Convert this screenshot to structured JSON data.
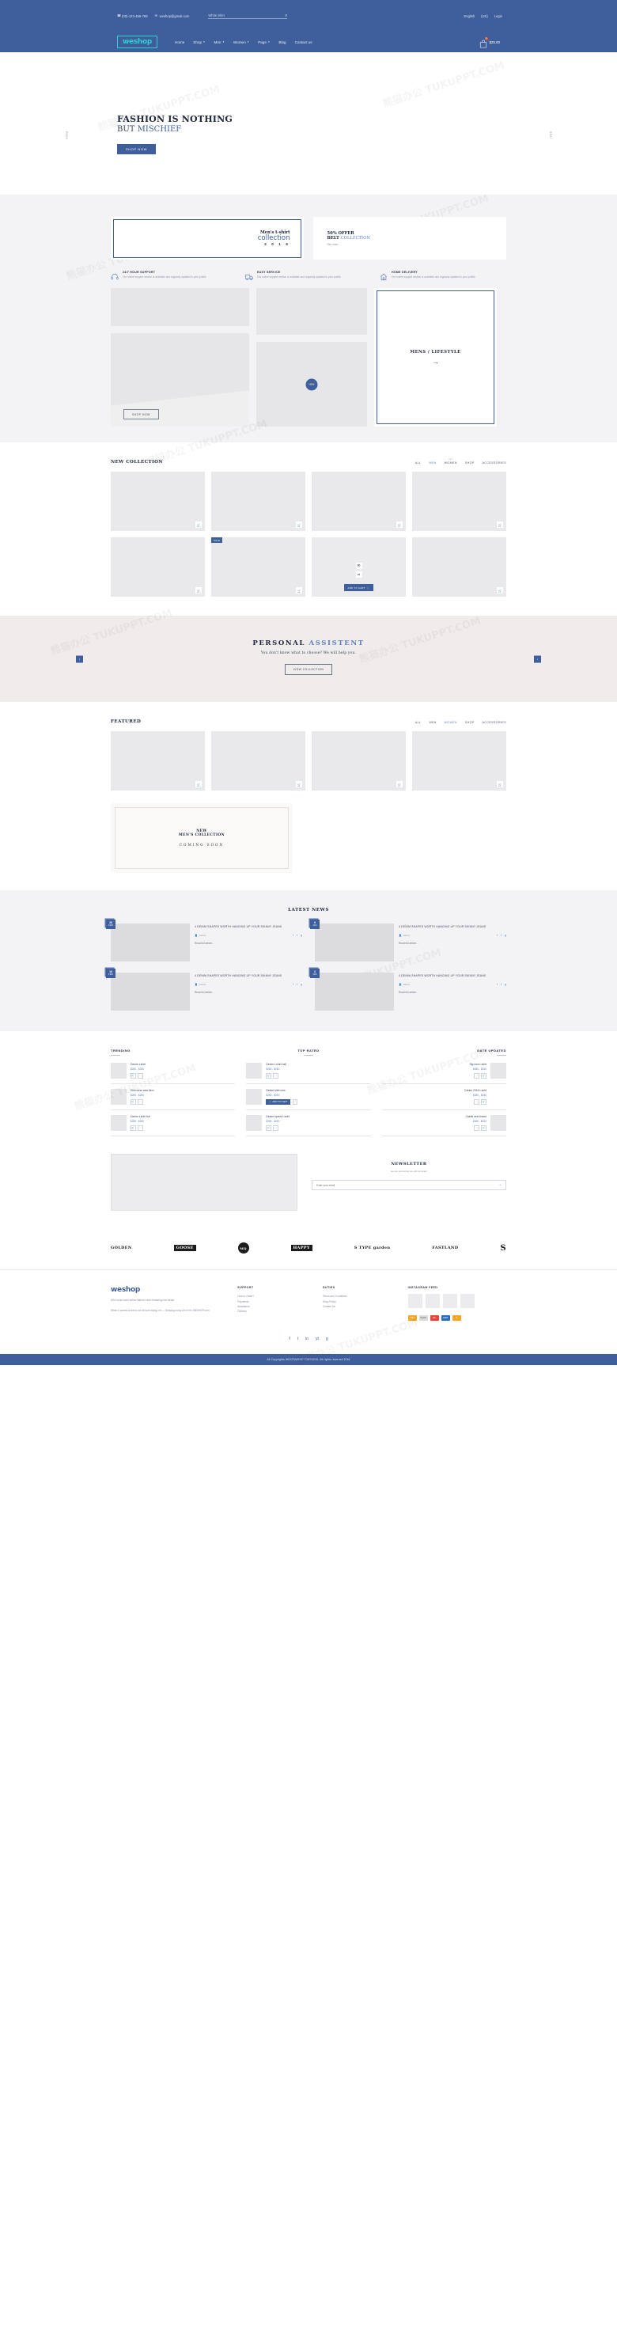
{
  "topbar": {
    "phone": "(00)-123-456-789",
    "email": "weshop@gmail.com",
    "phone_icon": "phone-icon",
    "email_icon": "envelope-icon",
    "search_placeholder": "White Shirt",
    "search_value": "",
    "search_icon": "search-icon",
    "language": "English",
    "currency": "(US)",
    "login": "Login"
  },
  "nav": {
    "logo": "weshop",
    "links": [
      {
        "label": "Home",
        "caret": false
      },
      {
        "label": "Shop",
        "caret": true
      },
      {
        "label": "Men",
        "caret": true
      },
      {
        "label": "Women",
        "caret": true
      },
      {
        "label": "Page",
        "caret": true
      },
      {
        "label": "Blog",
        "caret": false
      },
      {
        "label": "Contact us",
        "caret": false
      }
    ],
    "cart_icon": "shopping-bag-icon",
    "cart_count": "0",
    "cart_amount": "$25.00"
  },
  "hero": {
    "line1": "FASHION IS NOTHING",
    "line2_a": "BUT ",
    "line2_b": "MISCHIEF",
    "button": "SHOP NOW",
    "prev": "PREV",
    "next": "NEXT"
  },
  "promos": [
    {
      "l1": "Men's t-shirt",
      "l2": "collection",
      "l3": "2 0 1 6"
    },
    {
      "l1": "50% OFFER",
      "l2_a": "BELT ",
      "l2_b": "COLLECTION",
      "l3": "See more..."
    }
  ],
  "features": [
    {
      "icon": "headset-icon",
      "title": "24/7 HOUR SUPPORT",
      "desc": "Our online support section is available and regularly updated in your profile"
    },
    {
      "icon": "truck-icon",
      "title": "EASY SERVICE",
      "desc": "Our online support section is available and regularly updated in your profile"
    },
    {
      "icon": "home-icon",
      "title": "HOME DELIVERY",
      "desc": "Our online support section is available and regularly updated in your profile"
    }
  ],
  "banners": {
    "shop_now": "SHOP NOW",
    "circle_label": "NEW",
    "mens_lifestyle": "MENS / LIFESTYLE",
    "arrow_icon": "arrow-right-icon"
  },
  "new_collection": {
    "title": "NEW COLLECTION",
    "filters": [
      {
        "label": "ALL",
        "active": false,
        "count": ""
      },
      {
        "label": "MEN",
        "active": true,
        "count": ""
      },
      {
        "label": "WOMEN",
        "active": false,
        "count": "(0)"
      },
      {
        "label": "SHOP",
        "active": false,
        "count": ""
      },
      {
        "label": "ACCESSORIES",
        "active": false,
        "count": ""
      }
    ],
    "sale_tag": "SALE",
    "add_to_cart": "ADD TO CART",
    "cart_icon": "cart-icon",
    "eye_icon": "eye-icon",
    "compare_icon": "compare-icon"
  },
  "assistent": {
    "title_a": "PERSONAL ",
    "title_b": "ASSISTENT",
    "subtitle": "You don't know what to choose? We will help you.",
    "button": "VIEW COLLECTION",
    "prev_icon": "chevron-left-icon",
    "next_icon": "chevron-right-icon"
  },
  "featured": {
    "title": "FEATURED",
    "filters": [
      {
        "label": "ALL",
        "active": false
      },
      {
        "label": "MEN",
        "active": false
      },
      {
        "label": "WOMEN",
        "active": true
      },
      {
        "label": "SHOP",
        "active": false
      },
      {
        "label": "ACCESSORIES",
        "active": false
      }
    ]
  },
  "coming_soon": {
    "l1": "NEW",
    "l2": "MEN'S COLLECTION",
    "l3": "COMING SOON"
  },
  "news": {
    "title": "LATEST NEWS",
    "items": [
      {
        "day": "26",
        "month": "FEB",
        "headline": "4 DENIM SHAPES WORTH HANGING UP YOUR SKINNY JEANS",
        "author": "Admin",
        "read": "Read full article...",
        "social": [
          "f",
          "t",
          "g"
        ]
      },
      {
        "day": "9",
        "month": "JAN",
        "headline": "4 DENIM SHAPES WORTH HANGING UP YOUR SKINNY JEANS",
        "author": "Admin",
        "read": "Read full article...",
        "social": [
          "f",
          "t",
          "g"
        ]
      },
      {
        "day": "16",
        "month": "FEB",
        "headline": "4 DENIM SHAPES WORTH HANGING UP YOUR SKINNY JEANS",
        "author": "Admin",
        "read": "Read full article...",
        "social": [
          "f",
          "t",
          "g"
        ]
      },
      {
        "day": "3",
        "month": "JAN",
        "headline": "4 DENIM SHAPES WORTH HANGING UP YOUR SKINNY JEANS",
        "author": "Admin",
        "read": "Read full article...",
        "social": [
          "f",
          "t",
          "g"
        ]
      }
    ]
  },
  "lists": [
    {
      "heading": "TRENDING",
      "items": [
        {
          "name": "Denim t-shirt",
          "price": "$280 - $250",
          "acts": [
            "cart",
            "heart"
          ]
        },
        {
          "name": "Slim wear new item",
          "price": "$280 - $250",
          "acts": [
            "cart",
            "heart"
          ]
        },
        {
          "name": "Denim t-shirt full",
          "price": "$280 - $250",
          "acts": [
            "cart",
            "heart"
          ]
        }
      ]
    },
    {
      "heading": "TOP RATED",
      "items": [
        {
          "name": "Denim t-shirt half",
          "price": "$280 - $250",
          "acts": [
            "cart",
            "heart"
          ]
        },
        {
          "name": "Denim shirt new",
          "price": "$280 - $250",
          "acts": [
            "addcart",
            "heart"
          ]
        },
        {
          "name": "Denim sports t-shirt",
          "price": "$280 - $250",
          "acts": [
            "cart",
            "heart"
          ]
        }
      ]
    },
    {
      "heading": "DATE UPDATED",
      "items": [
        {
          "name": "Sig new t-shirt",
          "price": "$280 - $250",
          "acts": [
            "heart",
            "cart"
          ]
        },
        {
          "name": "Denim 2016 t-shirt",
          "price": "$280 - $250",
          "acts": [
            "heart",
            "cart"
          ]
        },
        {
          "name": "Castle new brand",
          "price": "$280 - $250",
          "acts": [
            "heart",
            "cart"
          ]
        }
      ]
    }
  ],
  "newsletter": {
    "title": "NEWSLETTER",
    "desc": "we are promoting we will not spam",
    "placeholder": "Enter your email",
    "value": "",
    "submit_icon": "arrow-right-icon"
  },
  "brands": [
    {
      "label": "GOLDEN",
      "style": "plain"
    },
    {
      "label": "GOOSE",
      "style": "inv"
    },
    {
      "label": "MQ",
      "style": "circ"
    },
    {
      "label": "HAPPY",
      "style": "inv"
    },
    {
      "label": "S TYPE garden",
      "style": "plain"
    },
    {
      "label": "FASTLAND",
      "style": "plain"
    },
    {
      "label": "S",
      "style": "big"
    }
  ],
  "footer": {
    "logo": "weshop",
    "about_1": "USA most-loved online fashion store featuring new deals.",
    "about_2": "When it comes to trend, we all love being in it — Seeping every bit of it in WESHOP.com",
    "columns": [
      {
        "heading": "SUPPORT",
        "links": [
          "How to Order?",
          "Payments",
          "Assistance",
          "Delivery"
        ]
      },
      {
        "heading": "DUTIES",
        "links": [
          "Terms and Conditions",
          "Shop Policy",
          "Contact Us"
        ]
      }
    ],
    "instagram_heading": "INSTAGRAM FEED",
    "payments": [
      "VISA",
      "PayPal",
      "MC",
      "AMEX",
      "D"
    ],
    "payment_colors": [
      "#f5a623",
      "#d8d8d8",
      "#e8453c",
      "#2a6ebb",
      "#f5a623"
    ],
    "social": [
      "f",
      "t",
      "in",
      "yt",
      "g"
    ],
    "copyright": "All Copyrights WESTMARKET DESIGNS. All rights reserved 2016"
  }
}
